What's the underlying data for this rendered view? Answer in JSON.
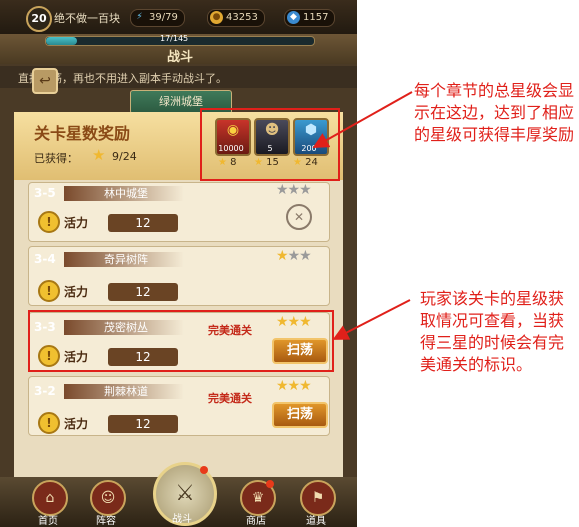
{
  "status_bar": {
    "level": "20",
    "player_name": "绝不做一百块",
    "energy": "39/79",
    "gold": "43253",
    "gems": "1157"
  },
  "header": {
    "xp": "17/145",
    "title": "战斗"
  },
  "tip": {
    "text": "直接扫荡，再也不用进入副本手动战斗了。"
  },
  "chapter": {
    "name": "绿洲城堡"
  },
  "star_reward": {
    "title": "关卡星数奖励",
    "obtained_label": "已获得：",
    "obtained_value": "9/24",
    "rewards": [
      {
        "amount": "10000",
        "stars": "8"
      },
      {
        "amount": "5",
        "stars": "15"
      },
      {
        "amount": "200",
        "stars": "24"
      }
    ]
  },
  "stages": [
    {
      "num": "3-5",
      "name": "林中城堡",
      "energy_label": "活力",
      "cost": "12",
      "stars": 0
    },
    {
      "num": "3-4",
      "name": "奇异树阵",
      "energy_label": "活力",
      "cost": "12",
      "stars": 1
    },
    {
      "num": "3-3",
      "name": "茂密树丛",
      "energy_label": "活力",
      "cost": "12",
      "stars": 3,
      "perfect": "完美通关",
      "sweep": "扫荡"
    },
    {
      "num": "3-2",
      "name": "荆棘林道",
      "energy_label": "活力",
      "cost": "12",
      "stars": 3,
      "perfect": "完美通关",
      "sweep": "扫荡"
    }
  ],
  "nav": {
    "home": "首页",
    "formation": "阵容",
    "battle": "战斗",
    "shop": "商店",
    "items": "道具"
  },
  "annotations": {
    "note1": "每个章节的总星级会显示在这边，达到了相应的星级可获得丰厚奖励",
    "note2": "玩家该关卡的星级获取情况可查看，当获得三星的时候会有完美通关的标识。"
  },
  "colors": {
    "annotation": "#e0201a",
    "star": "#f0b830",
    "sweep_button": "#d0801a"
  }
}
